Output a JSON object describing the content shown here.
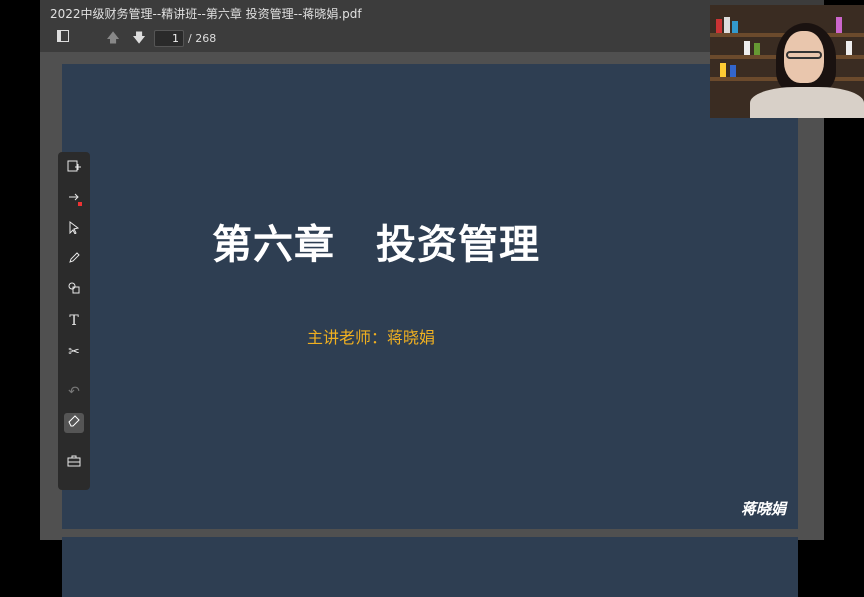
{
  "window": {
    "title": "2022中级财务管理--精讲班--第六章 投资管理--蒋晓娟.pdf"
  },
  "toolbar": {
    "current_page": "1",
    "total_pages": "/ 268"
  },
  "slide": {
    "title": "第六章　投资管理",
    "subtitle": "主讲老师：蒋晓娟",
    "signature": "蒋晓娟"
  },
  "side_tools": [
    {
      "name": "add-page-icon",
      "glyph": "⊕"
    },
    {
      "name": "move-tool-icon",
      "glyph": "⇄"
    },
    {
      "name": "select-arrow-icon",
      "glyph": "↖"
    },
    {
      "name": "pencil-icon",
      "glyph": "✎"
    },
    {
      "name": "shapes-icon",
      "glyph": "⧉"
    },
    {
      "name": "text-icon",
      "glyph": "T"
    },
    {
      "name": "scissors-icon",
      "glyph": "✂"
    },
    {
      "name": "undo-icon",
      "glyph": "↶"
    },
    {
      "name": "eraser-icon",
      "glyph": "⌫"
    },
    {
      "name": "toolbox-icon",
      "glyph": "▣"
    }
  ],
  "colors": {
    "slide_bg": "#2e3e52",
    "subtitle": "#f0b020",
    "chrome": "#3c3c3c"
  }
}
